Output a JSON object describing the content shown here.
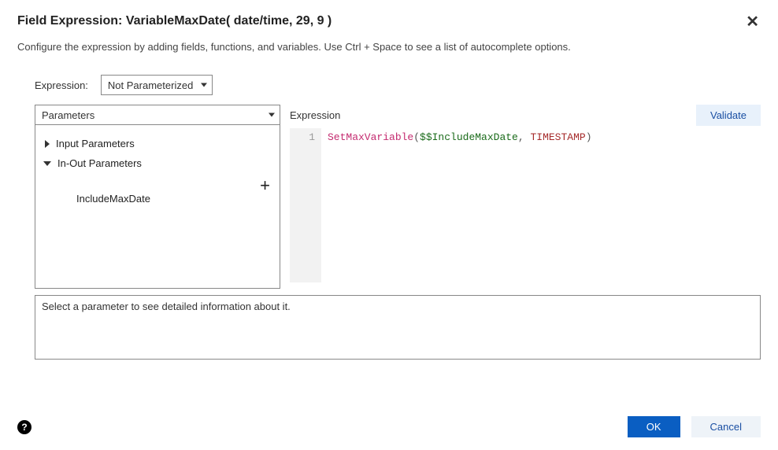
{
  "dialog": {
    "title": "Field Expression: VariableMaxDate( date/time, 29, 9 )",
    "close_glyph": "✕",
    "subtitle": "Configure the expression by adding fields, functions, and variables. Use Ctrl + Space to see a list of autocomplete options."
  },
  "expression_type": {
    "label": "Expression:",
    "selected": "Not Parameterized"
  },
  "parameters_panel": {
    "selector": "Parameters",
    "tree": {
      "input_params_label": "Input Parameters",
      "inout_params_label": "In-Out Parameters",
      "inout_children": [
        "IncludeMaxDate"
      ]
    },
    "add_glyph": "+"
  },
  "editor": {
    "label": "Expression",
    "validate_label": "Validate",
    "line_number": "1",
    "tokens": {
      "fn": "SetMaxVariable",
      "open": "(",
      "var": "$$IncludeMaxDate",
      "comma": ", ",
      "kw": "TIMESTAMP",
      "close": ")"
    }
  },
  "detail_panel": {
    "placeholder": "Select a parameter to see detailed information about it."
  },
  "footer": {
    "help_glyph": "?",
    "ok_label": "OK",
    "cancel_label": "Cancel"
  }
}
